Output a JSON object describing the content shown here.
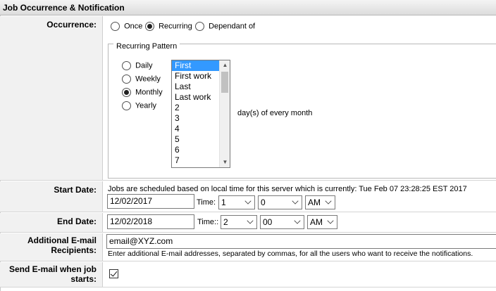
{
  "section_title": "Job Occurrence & Notification",
  "occurrence": {
    "label": "Occurrence:",
    "options": [
      "Once",
      "Recurring",
      "Dependant of"
    ],
    "selected": "Recurring"
  },
  "recurring_pattern": {
    "legend": "Recurring Pattern",
    "frequencies": [
      "Daily",
      "Weekly",
      "Monthly",
      "Yearly"
    ],
    "selected": "Monthly",
    "day_list": [
      "First",
      "First work",
      "Last",
      "Last work",
      "2",
      "3",
      "4",
      "5",
      "6",
      "7"
    ],
    "day_selected": "First",
    "suffix": "day(s) of every month"
  },
  "start_date": {
    "label": "Start Date:",
    "note": "Jobs are scheduled based on local time for this server which is currently: Tue Feb 07 23:28:25 EST 2017",
    "date": "12/02/2017",
    "time_label": "Time:",
    "hour": "1",
    "minute": "0",
    "ampm": "AM"
  },
  "end_date": {
    "label": "End Date:",
    "date": "12/02/2018",
    "time_label": "Time::",
    "hour": "2",
    "minute": "00",
    "ampm": "AM"
  },
  "additional_email": {
    "label": "Additional E-mail Recipients:",
    "value": "email@XYZ.com",
    "help": "Enter additional E-mail addresses, separated by commas, for all the users who want to receive the notifications."
  },
  "send_email": {
    "label": "Send E-mail when job starts:",
    "checked": true
  }
}
